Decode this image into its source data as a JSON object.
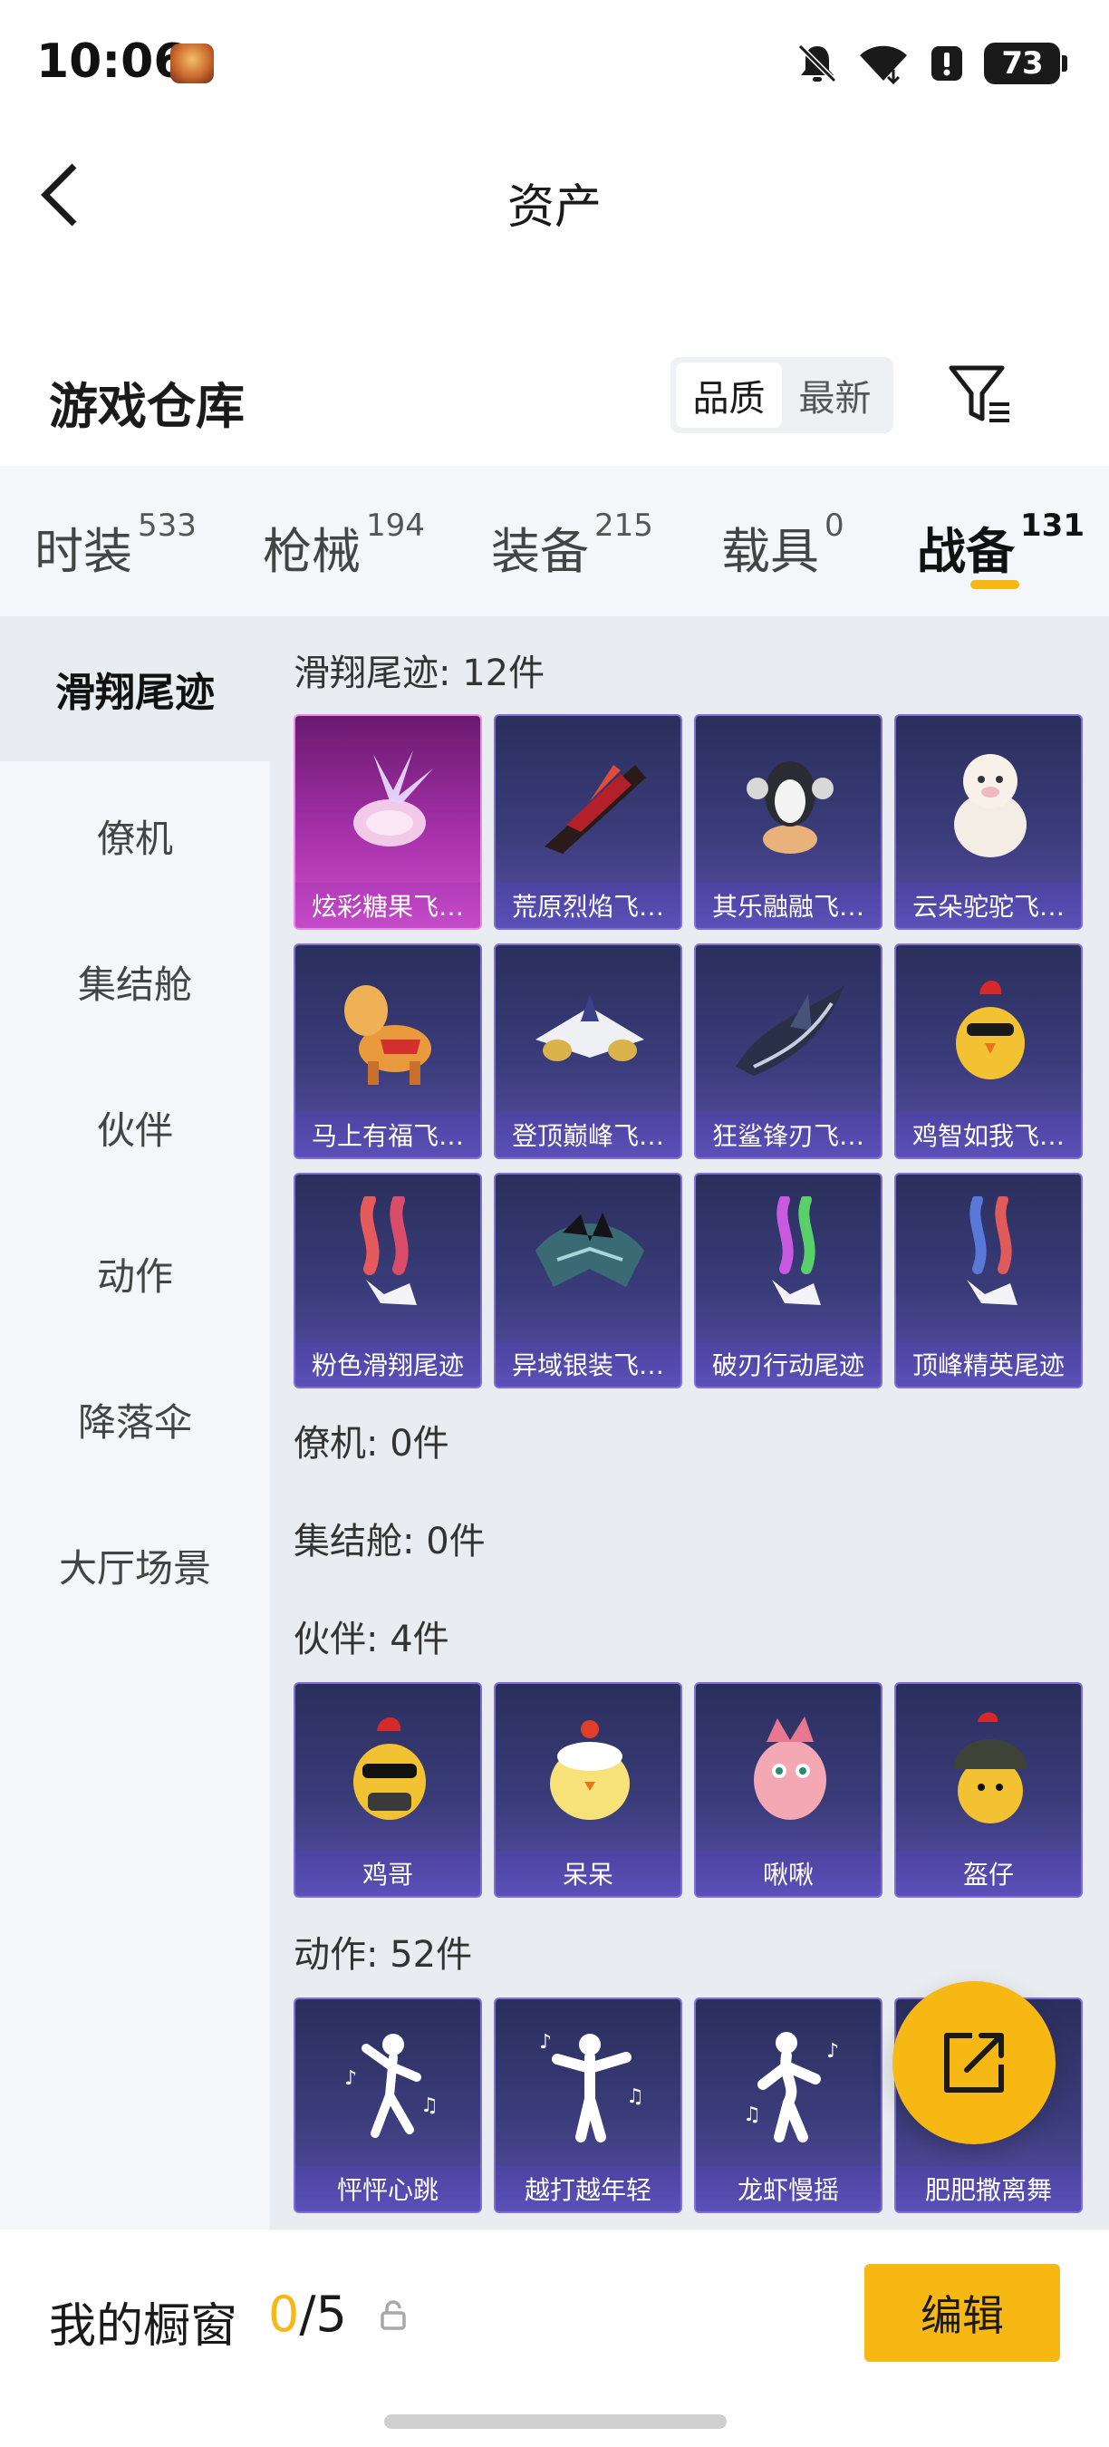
{
  "status_bar": {
    "time": "10:06",
    "battery": "73",
    "icons": [
      "game-app-icon",
      "bell-muted-icon",
      "wifi-icon",
      "alert-icon",
      "battery-icon"
    ]
  },
  "header": {
    "title": "资产",
    "back_icon": "chevron-left-icon"
  },
  "warehouse": {
    "title": "游戏仓库",
    "sort_options": [
      "品质",
      "最新"
    ],
    "selected_sort": "品质",
    "filter_icon": "filter-icon"
  },
  "tabs": [
    {
      "label": "时装",
      "count": "533"
    },
    {
      "label": "枪械",
      "count": "194"
    },
    {
      "label": "装备",
      "count": "215"
    },
    {
      "label": "载具",
      "count": "0"
    },
    {
      "label": "战备",
      "count": "131",
      "active": true
    }
  ],
  "sidebar": {
    "items": [
      "滑翔尾迹",
      "僚机",
      "集结舱",
      "伙伴",
      "动作",
      "降落伞",
      "大厅场景"
    ],
    "active": "滑翔尾迹"
  },
  "sections": [
    {
      "title": "滑翔尾迹: 12件",
      "items": [
        "炫彩糖果飞…",
        "荒原烈焰飞…",
        "其乐融融飞…",
        "云朵驼驼飞…",
        "马上有福飞…",
        "登顶巅峰飞…",
        "狂鲨锋刃飞…",
        "鸡智如我飞…",
        "粉色滑翔尾迹",
        "异域银装飞…",
        "破刃行动尾迹",
        "顶峰精英尾迹"
      ]
    },
    {
      "title": "僚机: 0件",
      "items": []
    },
    {
      "title": "集结舱: 0件",
      "items": []
    },
    {
      "title": "伙伴: 4件",
      "items": [
        "鸡哥",
        "呆呆",
        "啾啾",
        "盔仔"
      ]
    },
    {
      "title": "动作: 52件",
      "items": [
        "怦怦心跳",
        "越打越年轻",
        "龙虾慢摇",
        "肥肥撒离舞"
      ]
    }
  ],
  "fab": {
    "icon": "share-icon"
  },
  "bottom_bar": {
    "label": "我的橱窗",
    "count_used": "0",
    "count_total": "/5",
    "lock_icon": "lock-icon",
    "edit_label": "编辑"
  },
  "colors": {
    "accent": "#f8b814",
    "card_purple": "#3a3c7a",
    "card_pink": "#a02ea5"
  }
}
